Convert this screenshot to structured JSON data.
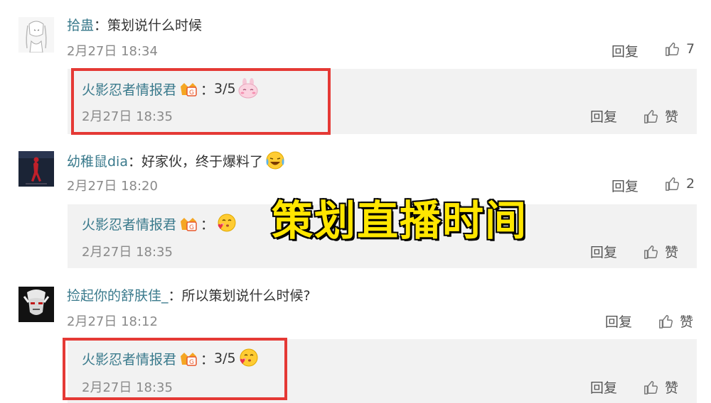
{
  "overlay_title": "策划直播时间",
  "comments": [
    {
      "username": "拾蛊",
      "separator": "：",
      "text": "策划说什么时候",
      "time": "2月27日 18:34",
      "reply_label": "回复",
      "like_count": "7",
      "reply": {
        "username": "火影忍者情报君",
        "separator": "：",
        "text": "3/5",
        "emoji": "shy-bunny-emoji",
        "time": "2月27日 18:35",
        "reply_label": "回复",
        "like_label": "赞"
      }
    },
    {
      "username": "幼稚鼠dia",
      "separator": "：",
      "text": "好家伙，终于爆料了",
      "emoji": "laugh-cry-emoji",
      "time": "2月27日 18:20",
      "reply_label": "回复",
      "like_count": "2",
      "reply": {
        "username": "火影忍者情报君",
        "separator": "：",
        "text": "",
        "emoji": "kiss-heart-emoji",
        "time": "2月27日 18:35",
        "reply_label": "回复",
        "like_label": "赞"
      }
    },
    {
      "username": "捡起你的舒肤佳_",
      "separator": "：",
      "text": "所以策划说什么时候?",
      "time": "2月27日 18:12",
      "reply_label": "回复",
      "like_label": "赞",
      "reply": {
        "username": "火影忍者情报君",
        "separator": "：",
        "text": "3/5",
        "emoji": "kiss-heart-emoji",
        "time": "2月27日 18:35",
        "reply_label": "回复",
        "like_label": "赞"
      }
    }
  ],
  "colors": {
    "username": "#3a7a8c",
    "highlight_box": "#e53935",
    "reply_bg": "#f2f2f2",
    "overlay_text": "#ffe600"
  }
}
